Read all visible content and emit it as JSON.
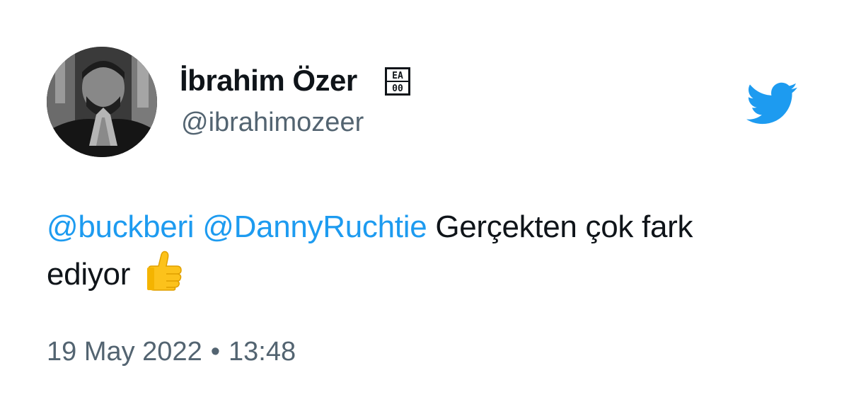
{
  "tweet": {
    "display_name": "İbrahim Özer",
    "handle": "@ibrahimozeer",
    "badge_text": "EA00",
    "mention_1": "@buckberi",
    "mention_2": "@DannyRuchtie",
    "text_line_1": "Gerçekten çok fark",
    "text_line_2": "ediyor",
    "date": "19 May 2022",
    "separator": "•",
    "time": "13:48"
  },
  "icons": {
    "brand": "twitter-bird-icon",
    "emoji": "thumbs-up-emoji",
    "badge": "ea-badge-icon"
  },
  "colors": {
    "mention": "#1d9bf0",
    "bird": "#1d9bf0",
    "text": "#0f1419",
    "muted": "#536471"
  }
}
